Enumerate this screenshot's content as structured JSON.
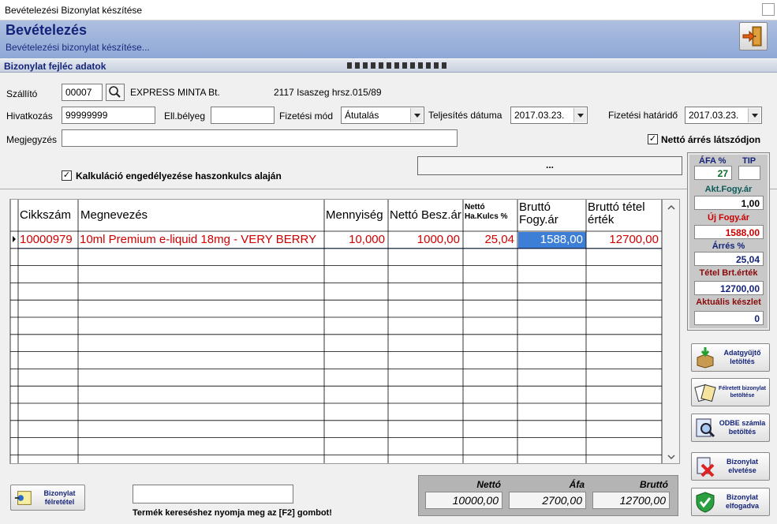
{
  "window": {
    "title": "Bevételezési Bizonylat készítése"
  },
  "header": {
    "title": "Bevételezés",
    "subtitle": "Bevételezési bizonylat készítése..."
  },
  "section": {
    "title": "Bizonylat fejléc adatok"
  },
  "form": {
    "szallito_label": "Szállító",
    "szallito_code": "00007",
    "szallito_name": "EXPRESS MINTA Bt.",
    "szallito_address": "2117 Isaszeg hrsz.015/89",
    "hivatkozas_label": "Hivatkozás",
    "hivatkozas_value": "99999999",
    "ellbelyeg_label": "Ell.bélyeg",
    "ellbelyeg_value": "",
    "fizmod_label": "Fizetési mód",
    "fizmod_value": "Átutalás",
    "teljesites_label": "Teljesítés dátuma",
    "teljesites_value": "2017.03.23.",
    "hatarido_label": "Fizetési határidő",
    "hatarido_value": "2017.03.23.",
    "megjegyzes_label": "Megjegyzés",
    "megjegyzes_value": "",
    "netto_arres_label": "Nettó árrés látszódjon",
    "netto_arres_checked": "✓",
    "kalkulacio_label": "Kalkuláció engedélyezése haszonkulcs alaján",
    "kalkulacio_checked": "✓",
    "ellipsis_button": "..."
  },
  "grid": {
    "columns": [
      "Cikkszám",
      "Megnevezés",
      "Mennyiség",
      "Nettó Besz.ár",
      "Nettó Ha.Kulcs %",
      "Bruttó Fogy.ár",
      "Bruttó tétel érték"
    ],
    "rows": [
      {
        "cikkszam": "10000979",
        "megnevezes": "10ml Premium e-liquid 18mg - VERY BERRY",
        "mennyiseg": "10,000",
        "netto_besz": "1000,00",
        "hakulcs": "25,04",
        "brutto_fogy": "1588,00",
        "brutto_tetel": "12700,00"
      }
    ]
  },
  "side": {
    "afa_label": "ÁFA %",
    "afa_value": "27",
    "tip_label": "TIP",
    "tip_value": "",
    "akt_label": "Akt.Fogy.ár",
    "akt_value": "1,00",
    "uj_label": "Új Fogy.ár",
    "uj_value": "1588,00",
    "arres_label": "Árrés %",
    "arres_value": "25,04",
    "tetel_label": "Tétel Brt.érték",
    "tetel_value": "12700,00",
    "keszlet_label": "Aktuális készlet",
    "keszlet_value": "0"
  },
  "buttons": {
    "adatgyujto": "Adatgyűjtő letöltés",
    "felretett": "Félretett bizonylat betöltése",
    "odbe": "ODBE számla betöltés",
    "elvetese": "Bizonylat elvetése",
    "elfogadva": "Bizonylat elfogadva",
    "felretetel": "Bizonylat félretétel"
  },
  "search": {
    "value": "",
    "hint": "Termék kereséshez nyomja meg az [F2] gombot!"
  },
  "totals": {
    "netto_label": "Nettó",
    "netto_value": "10000,00",
    "afa_label": "Áfa",
    "afa_value": "2700,00",
    "brutto_label": "Bruttó",
    "brutto_value": "12700,00"
  },
  "colors": {
    "accent": "#14247a",
    "red_text": "#d00000",
    "selected_cell": "#3d7ed6",
    "side_red": "#cc0000"
  }
}
